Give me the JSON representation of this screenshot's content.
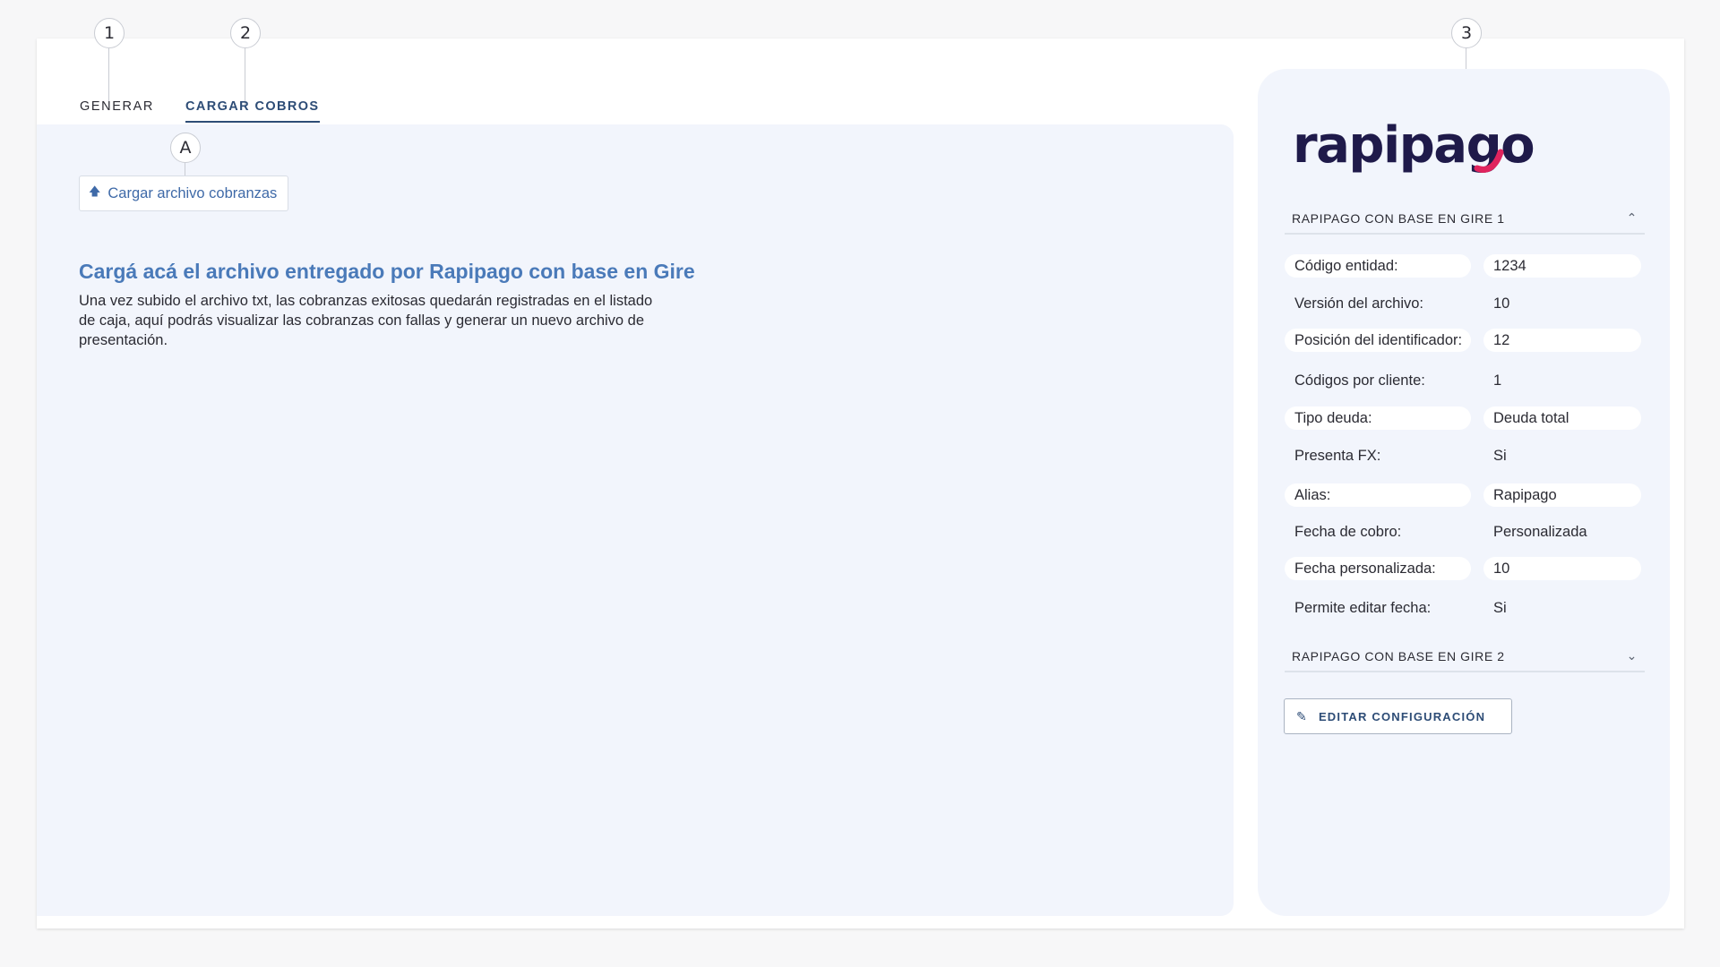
{
  "callouts": {
    "one": "1",
    "two": "2",
    "three": "3",
    "a": "A"
  },
  "tabs": {
    "generar": "GENERAR",
    "cargar_cobros": "CARGAR COBROS"
  },
  "main": {
    "upload_button": "Cargar archivo cobranzas",
    "title": "Cargá acá el archivo entregado por Rapipago con base en Gire",
    "description": "Una vez subido el archivo txt, las cobranzas exitosas quedarán registradas en el listado de caja, aquí podrás visualizar las cobranzas con fallas y generar un nuevo archivo de presentación."
  },
  "side": {
    "logo_text": "rapipago",
    "accordion1": {
      "title": "RAPIPAGO CON BASE EN GIRE 1",
      "expanded": true
    },
    "fields": [
      {
        "label": "Código entidad:",
        "value": "1234"
      },
      {
        "label": "Versión del archivo:",
        "value": "10"
      },
      {
        "label": "Posición del identificador:",
        "value": "12"
      },
      {
        "label": "Códigos por cliente:",
        "value": "1"
      },
      {
        "label": "Tipo deuda:",
        "value": "Deuda total"
      },
      {
        "label": "Presenta FX:",
        "value": "Si"
      },
      {
        "label": "Alias:",
        "value": "Rapipago"
      },
      {
        "label": "Fecha de cobro:",
        "value": "Personalizada"
      },
      {
        "label": "Fecha personalizada:",
        "value": "10"
      },
      {
        "label": "Permite editar fecha:",
        "value": "Si"
      }
    ],
    "accordion2": {
      "title": "RAPIPAGO CON BASE EN GIRE 2",
      "expanded": false
    },
    "edit_button": "EDITAR CONFIGURACIÓN"
  },
  "colors": {
    "accent": "#2d4c76",
    "link": "#4a7ab9",
    "panel_bg": "#f2f5fc",
    "logo_dark": "#1f1a4a",
    "logo_accent": "#e0245e"
  },
  "icons": {
    "upload": "upload-arrow-icon",
    "edit": "pencil-icon",
    "collapse": "chevron-up-icon",
    "expand": "chevron-down-icon"
  }
}
